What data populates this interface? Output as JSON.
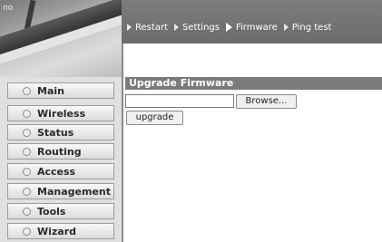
{
  "header": {
    "logo_text": "no",
    "nav": [
      {
        "label": "Restart",
        "active": false
      },
      {
        "label": "Settings",
        "active": false
      },
      {
        "label": "Firmware",
        "active": true
      },
      {
        "label": "Ping test",
        "active": false
      }
    ]
  },
  "sidebar": {
    "items": [
      {
        "label": "Main"
      },
      {
        "label": "Wireless"
      },
      {
        "label": "Status"
      },
      {
        "label": "Routing"
      },
      {
        "label": "Access"
      },
      {
        "label": "Management"
      },
      {
        "label": "Tools"
      },
      {
        "label": "Wizard"
      }
    ]
  },
  "main": {
    "section_title": "Upgrade Firmware",
    "file_input": {
      "value": "",
      "browse_label": "Browse..."
    },
    "upgrade_label": "upgrade"
  },
  "colors": {
    "nav_bar": "#737373",
    "section_header": "#7b7b7b",
    "sidebar_bg": "#e0e0e0"
  },
  "icons": {
    "nav_arrow": "triangle-right-icon",
    "menu_bullet": "circle-bullet-icon"
  }
}
